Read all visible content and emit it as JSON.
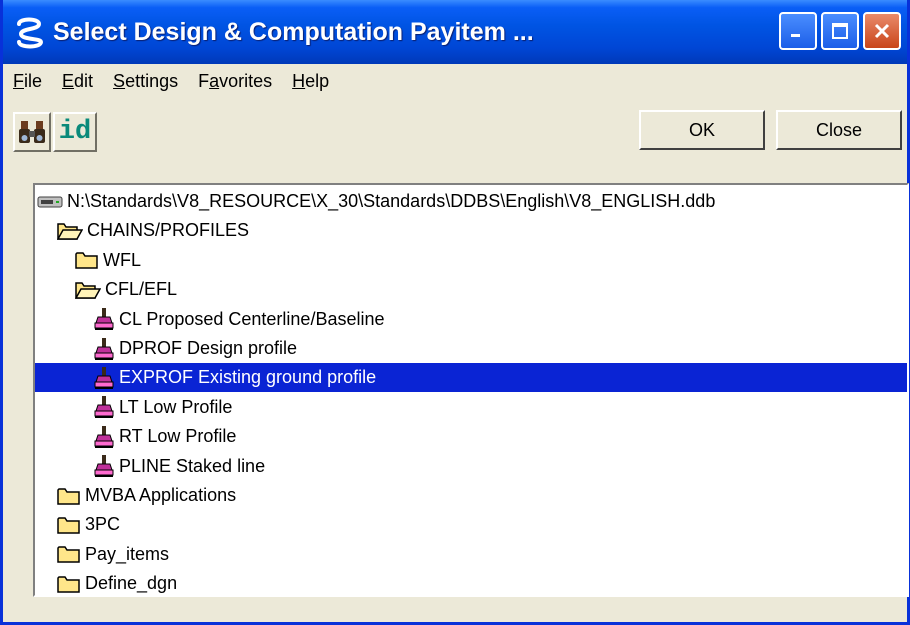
{
  "window": {
    "title": "Select Design & Computation Payitem ..."
  },
  "menu": {
    "items": [
      {
        "label": "File",
        "accel": "F"
      },
      {
        "label": "Edit",
        "accel": "E"
      },
      {
        "label": "Settings",
        "accel": "S"
      },
      {
        "label": "Favorites",
        "accel": "a"
      },
      {
        "label": "Help",
        "accel": "H"
      }
    ]
  },
  "toolbar": {
    "id_label": "id"
  },
  "buttons": {
    "ok": "OK",
    "close": "Close"
  },
  "tree": {
    "root": "N:\\Standards\\V8_RESOURCE\\X_30\\Standards\\DDBS\\English\\V8_ENGLISH.ddb",
    "items": [
      {
        "label": "CHAINS/PROFILES",
        "icon": "folder-open-icon",
        "level": 1,
        "selected": false
      },
      {
        "label": "WFL",
        "icon": "folder-icon",
        "level": 2,
        "selected": false
      },
      {
        "label": "CFL/EFL",
        "icon": "folder-open-icon",
        "level": 2,
        "selected": false
      },
      {
        "label": "CL Proposed Centerline/Baseline",
        "icon": "payitem-icon",
        "level": 3,
        "selected": false
      },
      {
        "label": "DPROF Design profile",
        "icon": "payitem-icon",
        "level": 3,
        "selected": false
      },
      {
        "label": "EXPROF Existing ground profile",
        "icon": "payitem-icon",
        "level": 3,
        "selected": true
      },
      {
        "label": "LT Low Profile",
        "icon": "payitem-icon",
        "level": 3,
        "selected": false
      },
      {
        "label": "RT Low Profile",
        "icon": "payitem-icon",
        "level": 3,
        "selected": false
      },
      {
        "label": "PLINE Staked line",
        "icon": "payitem-icon",
        "level": 3,
        "selected": false
      },
      {
        "label": "MVBA Applications",
        "icon": "folder-icon",
        "level": 1,
        "selected": false
      },
      {
        "label": "3PC",
        "icon": "folder-icon",
        "level": 1,
        "selected": false
      },
      {
        "label": "Pay_items",
        "icon": "folder-icon",
        "level": 1,
        "selected": false
      },
      {
        "label": "Define_dgn",
        "icon": "folder-icon",
        "level": 1,
        "selected": false
      }
    ]
  },
  "colors": {
    "selection": "#0a24d4",
    "titlebar": "#0054e3",
    "face": "#ece9d8"
  }
}
